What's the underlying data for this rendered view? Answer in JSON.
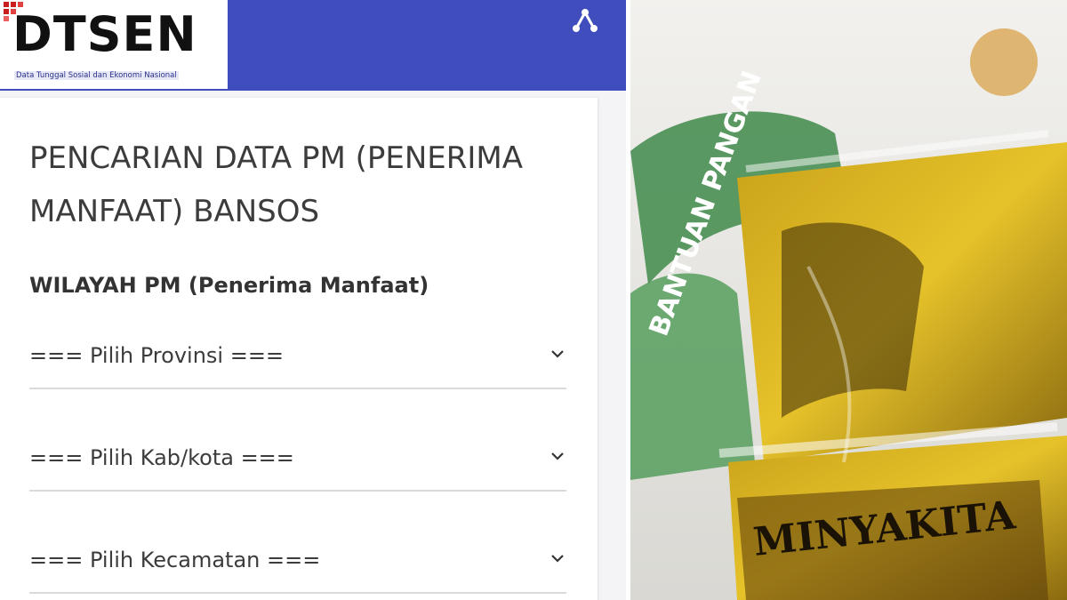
{
  "app": {
    "logo_text": "DTSEN",
    "logo_subtitle": "Data Tunggal Sosial dan Ekonomi Nasional",
    "brand_color": "#3f4ebc",
    "header_icon": "share-icon"
  },
  "main": {
    "title": "PENCARIAN DATA PM (PENERIMA MANFAAT) BANSOS",
    "section_heading": "WILAYAH PM (Penerima Manfaat)",
    "selects": [
      {
        "selected": "=== Pilih Provinsi ==="
      },
      {
        "selected": "=== Pilih Kab/kota ==="
      },
      {
        "selected": "=== Pilih Kecamatan ==="
      }
    ]
  },
  "photo": {
    "printed_text_bag": "BANTUAN PANGAN",
    "printed_text_oil": "MINYAKITA"
  }
}
